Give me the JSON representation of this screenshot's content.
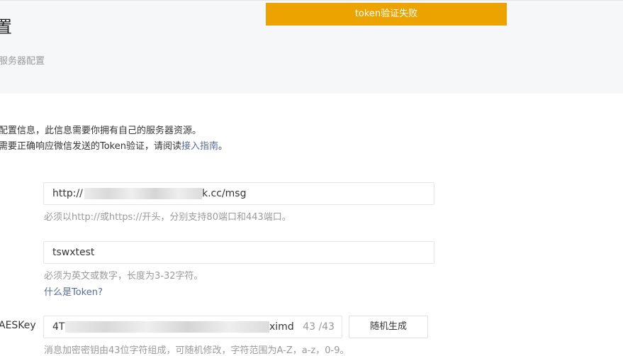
{
  "toast": {
    "text": "token验证失败"
  },
  "header": {
    "title": "置",
    "breadcrumb": "服务器配置"
  },
  "intro": {
    "line1": "配置信息，此信息需要你拥有自己的服务器资源。",
    "line2_prefix": "需要正确响应微信发送的Token验证，请阅读",
    "line2_link": "接入指南",
    "line2_suffix": "。"
  },
  "url_field": {
    "prefix": "http://",
    "suffix": "k.cc/msg",
    "hint": "必须以http://或https://开头，分别支持80端口和443端口。"
  },
  "token_field": {
    "value": "tswxtest",
    "hint": "必须为英文或数字，长度为3-32字符。",
    "link": "什么是Token?"
  },
  "aes_field": {
    "label": "AESKey",
    "prefix": "4T",
    "suffix": "ximd",
    "counter": "43 /43",
    "button": "随机生成",
    "hint": "消息加密密钥由43位字符组成，可随机修改，字符范围为A-Z，a-z，0-9。"
  }
}
